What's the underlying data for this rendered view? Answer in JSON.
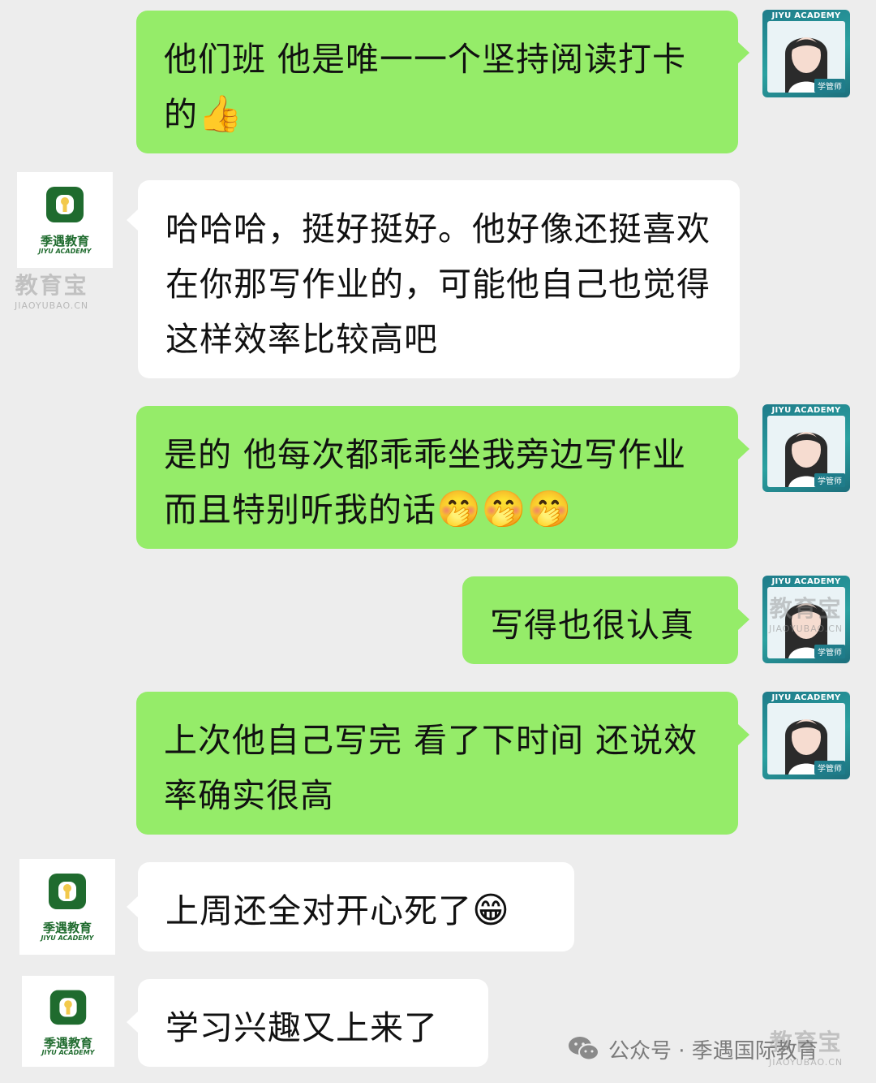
{
  "messages": [
    {
      "side": "me",
      "text": "他们班 他是唯一一个坚持阅读打卡的",
      "emoji": "👍"
    },
    {
      "side": "them",
      "text": "哈哈哈，挺好挺好。他好像还挺喜欢在你那写作业的，可能他自己也觉得这样效率比较高吧",
      "emoji": ""
    },
    {
      "side": "me",
      "text": "是的 他每次都乖乖坐我旁边写作业 而且特别听我的话",
      "emoji": "🤭🤭🤭"
    },
    {
      "side": "me",
      "text": "写得也很认真",
      "emoji": ""
    },
    {
      "side": "me",
      "text": "上次他自己写完 看了下时间 还说效率确实很高",
      "emoji": ""
    },
    {
      "side": "them",
      "text": "上周还全对开心死了",
      "emoji": "😁"
    },
    {
      "side": "them",
      "text": "学习兴趣又上来了",
      "emoji": ""
    }
  ],
  "teacher_avatar": {
    "brand": "JIYU ACADEMY",
    "role": "学管师"
  },
  "school_avatar": {
    "name": "季遇教育",
    "sub": "JIYU ACADEMY"
  },
  "watermark": {
    "cn": "教育宝",
    "en": "JIAOYUBAO.CN"
  },
  "footer": {
    "text": "公众号 · 季遇国际教育",
    "icon": "wechat-icon"
  },
  "colors": {
    "background": "#ededed",
    "my_bubble": "#95ec69",
    "their_bubble": "#ffffff",
    "brand_green": "#1f6b2e",
    "avatar_teal": "#1f7c8a"
  }
}
